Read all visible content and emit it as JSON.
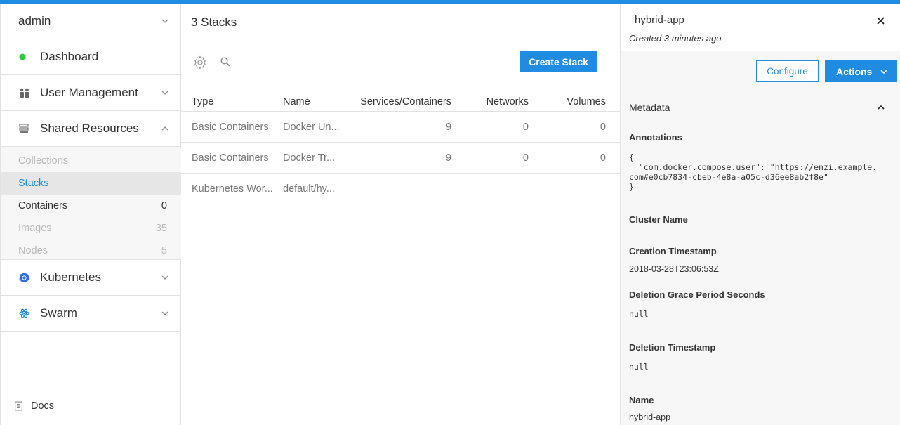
{
  "colors": {
    "accent": "#1f8ce2",
    "status_green": "#2ecc40"
  },
  "sidebar": {
    "user": "admin",
    "dashboard": "Dashboard",
    "user_management": "User Management",
    "shared_resources": "Shared Resources",
    "sub_items": [
      {
        "label": "Collections",
        "count": ""
      },
      {
        "label": "Stacks",
        "count": ""
      },
      {
        "label": "Containers",
        "count": "0"
      },
      {
        "label": "Images",
        "count": "35"
      },
      {
        "label": "Nodes",
        "count": "5"
      }
    ],
    "kubernetes": "Kubernetes",
    "swarm": "Swarm",
    "docs": "Docs"
  },
  "main": {
    "title": "3 Stacks",
    "create_button": "Create Stack",
    "columns": {
      "type": "Type",
      "name": "Name",
      "services": "Services/Containers",
      "networks": "Networks",
      "volumes": "Volumes"
    },
    "rows": [
      {
        "type": "Basic Containers",
        "name": "Docker Un...",
        "services": "9",
        "networks": "0",
        "volumes": "0"
      },
      {
        "type": "Basic Containers",
        "name": "Docker Tr...",
        "services": "9",
        "networks": "0",
        "volumes": "0"
      },
      {
        "type": "Kubernetes Wor...",
        "name": "default/hy...",
        "services": "",
        "networks": "",
        "volumes": ""
      }
    ]
  },
  "panel": {
    "title": "hybrid-app",
    "subtitle": "Created 3 minutes ago",
    "configure": "Configure",
    "actions": "Actions",
    "metadata": "Metadata",
    "annotations_label": "Annotations",
    "annotations_value": "{\n  \"com.docker.compose.user\": \"https://enzi.example.\ncom#e0cb7834-cbeb-4e8a-a05c-d36ee8ab2f8e\"\n}",
    "cluster_name_label": "Cluster Name",
    "creation_label": "Creation Timestamp",
    "creation_value": "2018-03-28T23:06:53Z",
    "grace_label": "Deletion Grace Period Seconds",
    "grace_value": "null",
    "deletion_label": "Deletion Timestamp",
    "deletion_value": "null",
    "name_label": "Name",
    "name_value": "hybrid-app"
  }
}
